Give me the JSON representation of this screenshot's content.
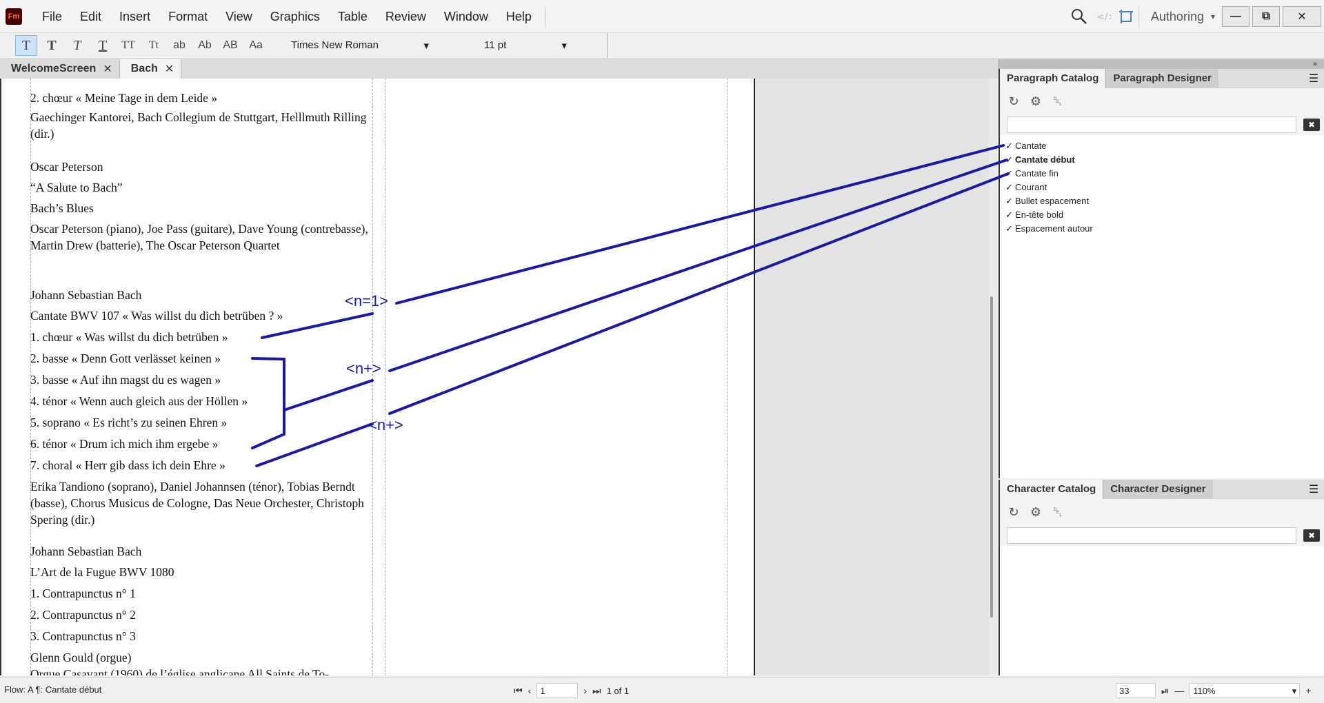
{
  "menubar": {
    "logo": "Fm",
    "items": [
      "File",
      "Edit",
      "Insert",
      "Format",
      "View",
      "Graphics",
      "Table",
      "Review",
      "Window",
      "Help"
    ],
    "workspace": "Authoring",
    "win_min": "—",
    "win_restore": "⧉",
    "win_close": "✕"
  },
  "toolbar": {
    "styles": [
      "T",
      "T",
      "T",
      "T",
      "TT",
      "Tt",
      "ab",
      "Ab",
      "AB",
      "Aa"
    ],
    "font": "Times New Roman",
    "size": "11 pt",
    "arrow": "▾"
  },
  "tabs": [
    {
      "label": "WelcomeScreen",
      "close": "✕"
    },
    {
      "label": "Bach",
      "close": "✕"
    }
  ],
  "document": {
    "paragraphs": [
      {
        "text": "2. chœur « Meine Tage in dem Leide »"
      },
      {
        "text": "Gaechinger Kantorei, Bach Collegium de Stuttgart, Helllmuth Rilling (dir.)"
      },
      {
        "text": "Oscar Peterson"
      },
      {
        "text": "“A Salute to Bach”"
      },
      {
        "text": "Bach’s Blues"
      },
      {
        "text": "Oscar Peterson (piano), Joe Pass (guitare), Dave Young (contrebasse), Martin Drew (batterie), The Oscar Peterson Quartet"
      },
      {
        "text": "Johann Sebastian Bach"
      },
      {
        "text": "Cantate BWV 107 « Was willst du dich betrüben ? »"
      },
      {
        "text": "1. chœur « Was willst du dich betrüben »"
      },
      {
        "text": "2. basse « Denn Gott verlässet keinen »"
      },
      {
        "text": "3. basse « Auf ihn magst du es wagen »"
      },
      {
        "text": "4. ténor « Wenn auch gleich aus der Höllen »"
      },
      {
        "text": "5. soprano « Es richt’s zu seinen Ehren »"
      },
      {
        "text": "6. ténor « Drum ich mich ihm ergebe »"
      },
      {
        "text": "7. choral « Herr gib dass ich dein Ehre »"
      },
      {
        "text": "Erika Tandiono (soprano), Daniel Johannsen (ténor), Tobias Berndt (basse), Chorus Musicus de Cologne, Das Neue Orchester, Christoph Spering (dir.)"
      },
      {
        "text": "Johann Sebastian Bach"
      },
      {
        "text": "L’Art de la Fugue BWV 1080"
      },
      {
        "text": "1. Contrapunctus n° 1"
      },
      {
        "text": "2. Contrapunctus n° 2"
      },
      {
        "text": "3. Contrapunctus n° 3"
      },
      {
        "text": "Glenn Gould (orgue)"
      },
      {
        "text": "Orgue Casavant (1960) de l’église anglicane All Saints de To-"
      }
    ],
    "annotations": [
      "<n=1>",
      "<n+>",
      "<n+>"
    ]
  },
  "paragraph_panel": {
    "tabs": [
      "Paragraph Catalog",
      "Paragraph Designer"
    ],
    "items": [
      {
        "label": "Cantate",
        "check": "✓",
        "bold": false
      },
      {
        "label": "Cantate début",
        "check": "✓",
        "bold": true
      },
      {
        "label": "Cantate fin",
        "check": "✓",
        "bold": false
      },
      {
        "label": "Courant",
        "check": "✓",
        "bold": false
      },
      {
        "label": "Bullet espacement",
        "check": "✓",
        "bold": false
      },
      {
        "label": "En-tête bold",
        "check": "✓",
        "bold": false
      },
      {
        "label": "Espacement autour",
        "check": "✓",
        "bold": false
      }
    ],
    "tool_refresh": "↻",
    "tool_settings": "⚙",
    "tool_delete": "␡",
    "menu": "☰",
    "clear": "✖"
  },
  "character_panel": {
    "tabs": [
      "Character Catalog",
      "Character Designer"
    ],
    "tool_refresh": "↻",
    "tool_settings": "⚙",
    "tool_delete": "␡",
    "menu": "☰",
    "clear": "✖"
  },
  "panel_collapse": "»",
  "statusbar": {
    "flow": "Flow: A ¶: Cantate début",
    "page": "1",
    "page_of": "1 of 1",
    "row": "33",
    "zoom": "110%",
    "first": "⏮",
    "last": "⏭",
    "prev": "‹",
    "next": "›",
    "minus": "—",
    "plus": "+",
    "jump": "⏯"
  }
}
